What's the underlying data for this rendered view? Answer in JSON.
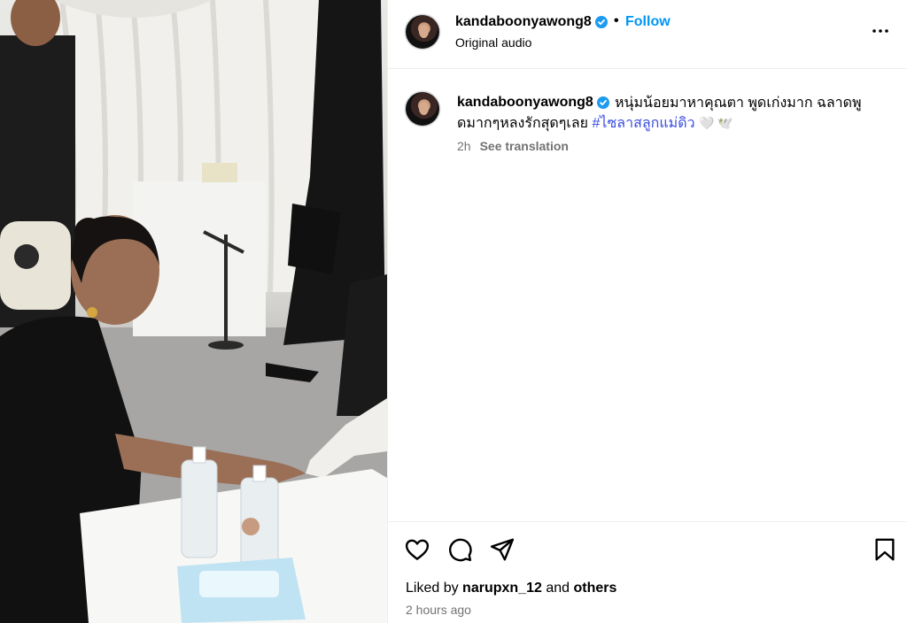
{
  "post": {
    "username": "kandaboonyawong8",
    "verified": true,
    "follow_label": "Follow",
    "separator": "•",
    "audio_label": "Original audio",
    "more_icon": "more-horizontal-icon"
  },
  "caption": {
    "username": "kandaboonyawong8",
    "text_line1": "หนุ่มน้อยมาหาคุณตา พูดเก่งมาก ฉลาดพู",
    "text_line2_prefix": "ดมากๆหลงรักสุดๆเลย ",
    "hashtag": "#ไซลาสลูกแม่ดิว",
    "emoji": "🤍 🕊️",
    "age": "2h",
    "see_translation": "See translation"
  },
  "actions": {
    "like_icon": "heart-icon",
    "comment_icon": "comment-icon",
    "share_icon": "send-icon",
    "save_icon": "bookmark-icon",
    "liked_by_prefix": "Liked by",
    "liked_by_user": "narupxn_12",
    "liked_by_and": "and",
    "liked_by_others": "others",
    "timestamp": "2 hours ago"
  },
  "colors": {
    "follow": "#0095f6",
    "hashtag": "#3a4de0",
    "secondary_text": "#737373",
    "verified_badge": "#1d9bf0"
  }
}
